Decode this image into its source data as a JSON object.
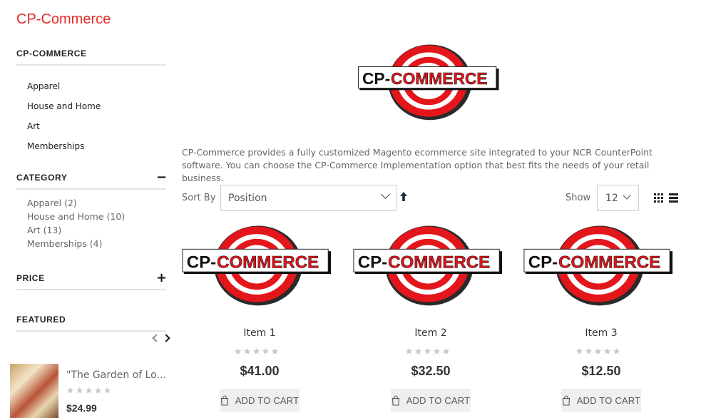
{
  "page": {
    "title": "CP-Commerce"
  },
  "sidebar": {
    "store_block": {
      "title": "CP-COMMERCE",
      "links": [
        "Apparel",
        "House and Home",
        "Art",
        "Memberships"
      ]
    },
    "category": {
      "title": "CATEGORY",
      "toggle": "−",
      "options": [
        "Apparel (2)",
        "House and Home (10)",
        "Art (13)",
        "Memberships (4)"
      ]
    },
    "price": {
      "title": "PRICE",
      "toggle": "+"
    },
    "featured": {
      "title": "FEATURED",
      "item": {
        "name": "\"The Garden of Lo...",
        "price": "$24.99",
        "rating": 0
      }
    }
  },
  "logo": {
    "left_text": "CP-",
    "right_text": "COMMERCE"
  },
  "main": {
    "description": "CP-Commerce provides a fully customized Magento ecommerce site integrated to your NCR CounterPoint software. You can choose the CP-Commerce Implementation option that best fits the needs of your retail business.",
    "toolbar": {
      "sort_label": "Sort By",
      "sort_value": "Position",
      "show_label": "Show",
      "limit_value": "12"
    },
    "products": [
      {
        "name": "Item 1",
        "price": "$41.00",
        "rating": 0,
        "button": "ADD TO CART"
      },
      {
        "name": "Item 2",
        "price": "$32.50",
        "rating": 0,
        "button": "ADD TO CART"
      },
      {
        "name": "Item 3",
        "price": "$12.50",
        "rating": 0,
        "button": "ADD TO CART"
      }
    ]
  },
  "colors": {
    "brand_red": "#e02b27",
    "star_empty": "#c7c7c7"
  }
}
